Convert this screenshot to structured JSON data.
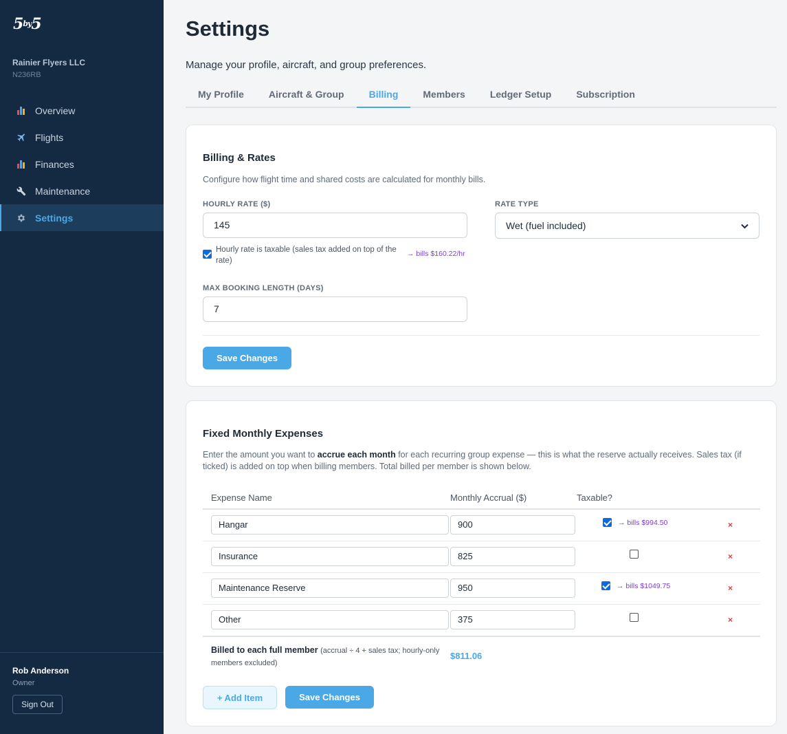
{
  "sidebar": {
    "logo": "5by5",
    "org_name": "Rainier Flyers LLC",
    "tail_number": "N236RB",
    "items": [
      {
        "label": "Overview",
        "icon": "bar-chart-icon"
      },
      {
        "label": "Flights",
        "icon": "airplane-icon"
      },
      {
        "label": "Finances",
        "icon": "bar-chart-icon"
      },
      {
        "label": "Maintenance",
        "icon": "wrench-icon"
      },
      {
        "label": "Settings",
        "icon": "gear-icon",
        "active": true
      }
    ],
    "user_name": "Rob Anderson",
    "user_role": "Owner",
    "sign_out": "Sign Out"
  },
  "page": {
    "title": "Settings",
    "subtitle": "Manage your profile, aircraft, and group preferences."
  },
  "tabs": [
    {
      "label": "My Profile"
    },
    {
      "label": "Aircraft & Group"
    },
    {
      "label": "Billing",
      "active": true
    },
    {
      "label": "Members"
    },
    {
      "label": "Ledger Setup"
    },
    {
      "label": "Subscription"
    }
  ],
  "billing": {
    "title": "Billing & Rates",
    "description": "Configure how flight time and shared costs are calculated for monthly bills.",
    "hourly_rate_label": "HOURLY RATE ($)",
    "hourly_rate_value": "145",
    "taxable_label": "Hourly rate is taxable (sales tax added on top of the rate)",
    "taxable_checked": true,
    "taxed_rate_note": "→ bills $160.22/hr",
    "rate_type_label": "RATE TYPE",
    "rate_type_value": "Wet (fuel included)",
    "max_booking_label": "MAX BOOKING LENGTH (DAYS)",
    "max_booking_value": "7",
    "save_label": "Save Changes"
  },
  "expenses": {
    "title": "Fixed Monthly Expenses",
    "description_before": "Enter the amount you want to ",
    "description_bold": "accrue each month",
    "description_after": " for each recurring group expense — this is what the reserve actually receives. Sales tax (if ticked) is added on top when billing members. Total billed per member is shown below.",
    "columns": [
      "Expense Name",
      "Monthly Accrual ($)",
      "Taxable?"
    ],
    "rows": [
      {
        "name": "Hangar",
        "amount": "900",
        "taxable": true,
        "billed_note": "→ bills $994.50"
      },
      {
        "name": "Insurance",
        "amount": "825",
        "taxable": false,
        "billed_note": ""
      },
      {
        "name": "Maintenance Reserve",
        "amount": "950",
        "taxable": true,
        "billed_note": "→ bills $1049.75"
      },
      {
        "name": "Other",
        "amount": "375",
        "taxable": false,
        "billed_note": ""
      }
    ],
    "remove_symbol": "×",
    "total_label": "Billed to each full member",
    "total_note": "(accrual ÷ 4 + sales tax; hourly-only members excluded)",
    "total_value": "$811.06",
    "add_item_label": "+ Add Item",
    "save_label": "Save Changes"
  },
  "colors": {
    "sidebar_bg": "#132a42",
    "accent": "#4aa8e6",
    "note_purple": "#7b3fd6",
    "remove_red": "#e23b3b"
  }
}
